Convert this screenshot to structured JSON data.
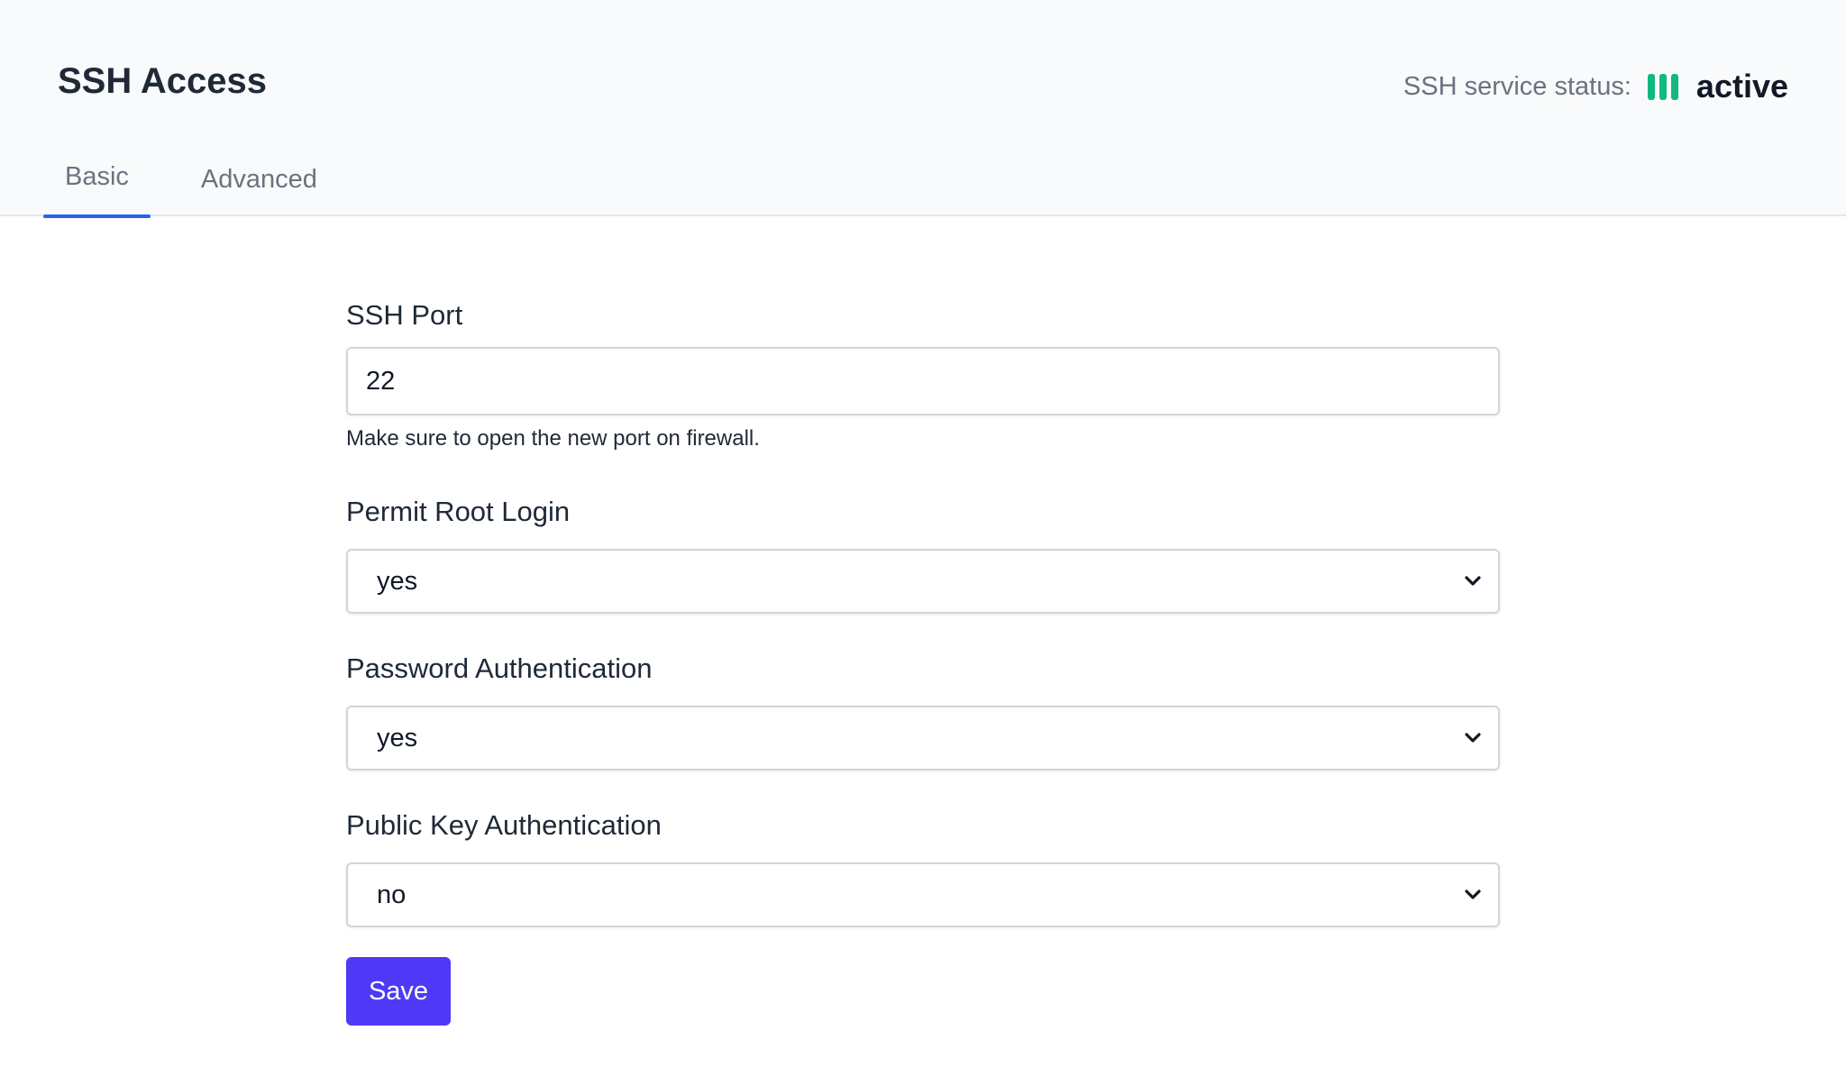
{
  "header": {
    "title": "SSH Access",
    "status_label": "SSH service status:",
    "status_value": "active",
    "status_color": "#10b981",
    "status_icon": "signal-bars-icon"
  },
  "tabs": [
    {
      "label": "Basic",
      "active": true
    },
    {
      "label": "Advanced",
      "active": false
    }
  ],
  "form": {
    "ssh_port": {
      "label": "SSH Port",
      "value": "22",
      "help": "Make sure to open the new port on firewall."
    },
    "permit_root_login": {
      "label": "Permit Root Login",
      "value": "yes"
    },
    "password_authentication": {
      "label": "Password Authentication",
      "value": "yes"
    },
    "public_key_authentication": {
      "label": "Public Key Authentication",
      "value": "no"
    },
    "select_icon": "chevron-down-icon",
    "save_label": "Save",
    "save_color": "#4f39f6"
  },
  "theme": {
    "accent": "#2563eb",
    "header_bg": "#f9fafb"
  }
}
